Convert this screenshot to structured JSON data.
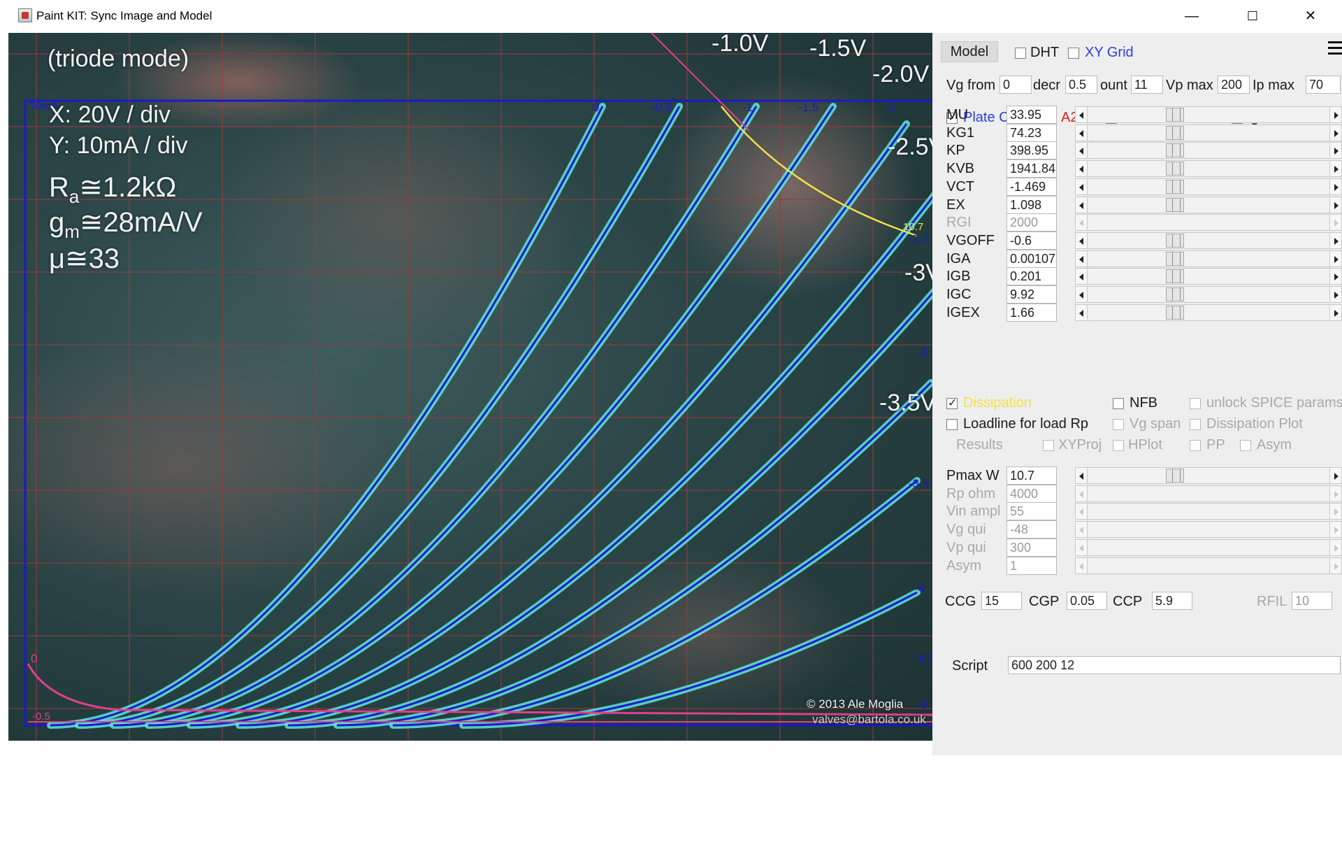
{
  "window": {
    "title": "Paint KIT: Sync Image and Model",
    "controls": {
      "minimize": "—",
      "maximize": "☐",
      "close": "✕"
    }
  },
  "plot": {
    "photo_texts": {
      "triode_mode": "(triode mode)",
      "x_scale": "X: 20V / div",
      "y_scale": "Y: 10mA / div",
      "ra": "R",
      "ra_sub": "a",
      "ra_val": "≅1.2kΩ",
      "gm": "g",
      "gm_sub": "m",
      "gm_val": "≅28mA/V",
      "mu": "μ≅33",
      "copyright": "© 2013 Ale Moglia",
      "email": "valves@bartola.co.uk"
    },
    "photo_curve_labels": [
      "-1.0V",
      "-1.5V",
      "-2.0V",
      "-2.5V",
      "-3V",
      "-3.5V"
    ],
    "axis_label": "70mA",
    "grid_labels": [
      "0",
      "-0.5",
      "-1",
      "-1.5",
      "-2",
      "-2.5",
      "-3",
      "-3.5",
      "-4",
      "-4.5",
      "-5"
    ],
    "dissipation_label": "10.7",
    "grid_current_labels": [
      "0",
      "-0.5"
    ],
    "colors": {
      "model_curves": "#1a1acc",
      "photo_curves": "#5fe6d8",
      "grid_current": "#e0408a",
      "dissipation": "#f2e24a"
    }
  },
  "panel": {
    "tab_model": "Model",
    "dht": "DHT",
    "xy_grid": "XY Grid",
    "menu_icon": "hamburger-icon",
    "vg_from_label": "Vg from",
    "vg_from": "0",
    "decr_label": "decr",
    "decr": "0.5",
    "count_label": "ount",
    "count": "11",
    "vp_max_label": "Vp max",
    "vp_max": "200",
    "ip_max_label": "Ip max",
    "ip_max": "70",
    "plate_current": "Plate Current",
    "a2": "A2",
    "grid_current": "Grid Current",
    "ig_level": "Ig Level 2",
    "params": [
      {
        "label": "MU",
        "value": "33.95",
        "enabled": true
      },
      {
        "label": "KG1",
        "value": "74.23",
        "enabled": true
      },
      {
        "label": "KP",
        "value": "398.95",
        "enabled": true
      },
      {
        "label": "KVB",
        "value": "1941.84",
        "enabled": true
      },
      {
        "label": "VCT",
        "value": "-1.469",
        "enabled": true
      },
      {
        "label": "EX",
        "value": "1.098",
        "enabled": true
      },
      {
        "label": "RGI",
        "value": "2000",
        "enabled": false
      },
      {
        "label": "VGOFF",
        "value": "-0.6",
        "enabled": true
      },
      {
        "label": "IGA",
        "value": "0.00107",
        "enabled": true
      },
      {
        "label": "IGB",
        "value": "0.201",
        "enabled": true
      },
      {
        "label": "IGC",
        "value": "9.92",
        "enabled": true
      },
      {
        "label": "IGEX",
        "value": "1.66",
        "enabled": true
      }
    ],
    "dissipation": "Dissipation",
    "nfb": "NFB",
    "unlock_spice": "unlock SPICE params",
    "loadline": "Loadline for load Rp",
    "vg_span": "Vg span",
    "dissipation_plot": "Dissipation Plot",
    "results": "Results",
    "xyproj": "XYProj",
    "hplot": "HPlot",
    "pp": "PP",
    "asym_cb": "Asym",
    "params2": [
      {
        "label": "Pmax W",
        "value": "10.7",
        "enabled": true
      },
      {
        "label": "Rp ohm",
        "value": "4000",
        "enabled": false
      },
      {
        "label": "Vin ampl",
        "value": "55",
        "enabled": false
      },
      {
        "label": "Vg qui",
        "value": "-48",
        "enabled": false
      },
      {
        "label": "Vp qui",
        "value": "300",
        "enabled": false
      },
      {
        "label": "Asym",
        "value": "1",
        "enabled": false
      }
    ],
    "ccg_label": "CCG",
    "ccg": "15",
    "cgp_label": "CGP",
    "cgp": "0.05",
    "ccp_label": "CCP",
    "ccp": "5.9",
    "rfil_label": "RFIL",
    "rfil": "10",
    "script_label": "Script",
    "script": "600 200 12"
  }
}
